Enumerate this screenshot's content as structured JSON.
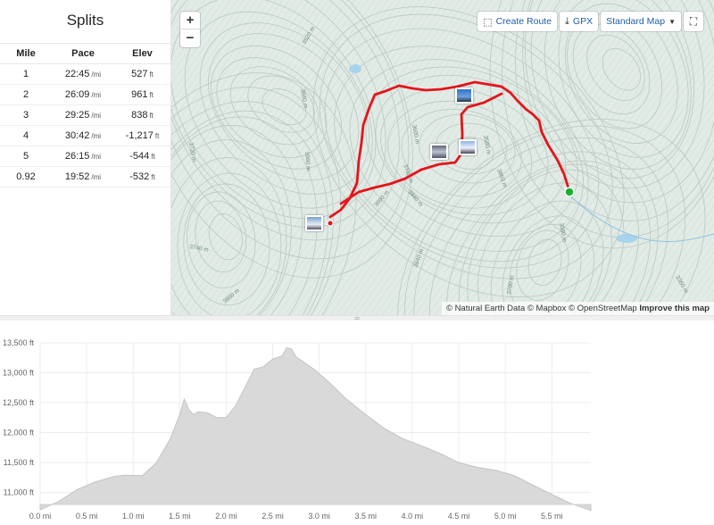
{
  "splits": {
    "title": "Splits",
    "headers": [
      "Mile",
      "Pace",
      "Elev"
    ],
    "pace_unit": "/mi",
    "elev_unit": "ft",
    "rows": [
      {
        "mile": "1",
        "pace": "22:45",
        "elev": "527"
      },
      {
        "mile": "2",
        "pace": "26:09",
        "elev": "961"
      },
      {
        "mile": "3",
        "pace": "29:25",
        "elev": "838"
      },
      {
        "mile": "4",
        "pace": "30:42",
        "elev": "-1,217"
      },
      {
        "mile": "5",
        "pace": "26:15",
        "elev": "-544"
      },
      {
        "mile": "0.92",
        "pace": "19:52",
        "elev": "-532"
      }
    ]
  },
  "map": {
    "zoom_in": "+",
    "zoom_out": "−",
    "create_route_label": "Create Route",
    "gpx_label": "GPX",
    "map_style_label": "Standard Map",
    "attribution": "© Natural Earth Data © Mapbox © OpenStreetMap",
    "attribution_link": "Improve this map",
    "contour_labels": [
      "3520 m",
      "3860 m",
      "3720 m",
      "3660 m",
      "3780 m",
      "3840 m",
      "3690 m",
      "3840 m",
      "3560 m",
      "3740 m",
      "3700 m",
      "3660 m",
      "3860 m",
      "3380 m",
      "3360 m",
      "3600 m"
    ],
    "route_color": "#e5141b",
    "end_marker_color": "#1fae33",
    "icons": [
      "create-route-icon",
      "download-icon",
      "caret-down-icon",
      "fullscreen-icon"
    ]
  },
  "chart_data": {
    "type": "area",
    "x_unit": "mi",
    "y_unit": "ft",
    "xlim": [
      0,
      5.92
    ],
    "ylim": [
      10800,
      13500
    ],
    "x_ticks": [
      "0.0 mi",
      "0.5 mi",
      "1.0 mi",
      "1.5 mi",
      "2.0 mi",
      "2.5 mi",
      "3.0 mi",
      "3.5 mi",
      "4.0 mi",
      "4.5 mi",
      "5.0 mi",
      "5.5 mi"
    ],
    "y_ticks": [
      "11,000 ft",
      "11,500 ft",
      "12,000 ft",
      "12,500 ft",
      "13,000 ft",
      "13,500 ft"
    ],
    "x": [
      0,
      0.2,
      0.4,
      0.6,
      0.8,
      0.9,
      1.1,
      1.25,
      1.4,
      1.5,
      1.55,
      1.6,
      1.65,
      1.7,
      1.8,
      1.9,
      2.0,
      2.1,
      2.2,
      2.3,
      2.4,
      2.5,
      2.6,
      2.65,
      2.7,
      2.75,
      2.85,
      2.95,
      3.1,
      3.3,
      3.5,
      3.7,
      3.9,
      4.1,
      4.3,
      4.5,
      4.7,
      4.9,
      5.1,
      5.3,
      5.5,
      5.7,
      5.92
    ],
    "y": [
      10710,
      10850,
      11050,
      11180,
      11270,
      11290,
      11280,
      11500,
      11900,
      12300,
      12560,
      12380,
      12300,
      12350,
      12330,
      12250,
      12250,
      12450,
      12750,
      13060,
      13100,
      13230,
      13280,
      13420,
      13400,
      13270,
      13160,
      13050,
      12850,
      12550,
      12300,
      12070,
      11900,
      11780,
      11650,
      11500,
      11420,
      11370,
      11280,
      11120,
      10970,
      10820,
      10700
    ],
    "fill": "#d9d9d9",
    "stroke": "#c4c4c4"
  }
}
